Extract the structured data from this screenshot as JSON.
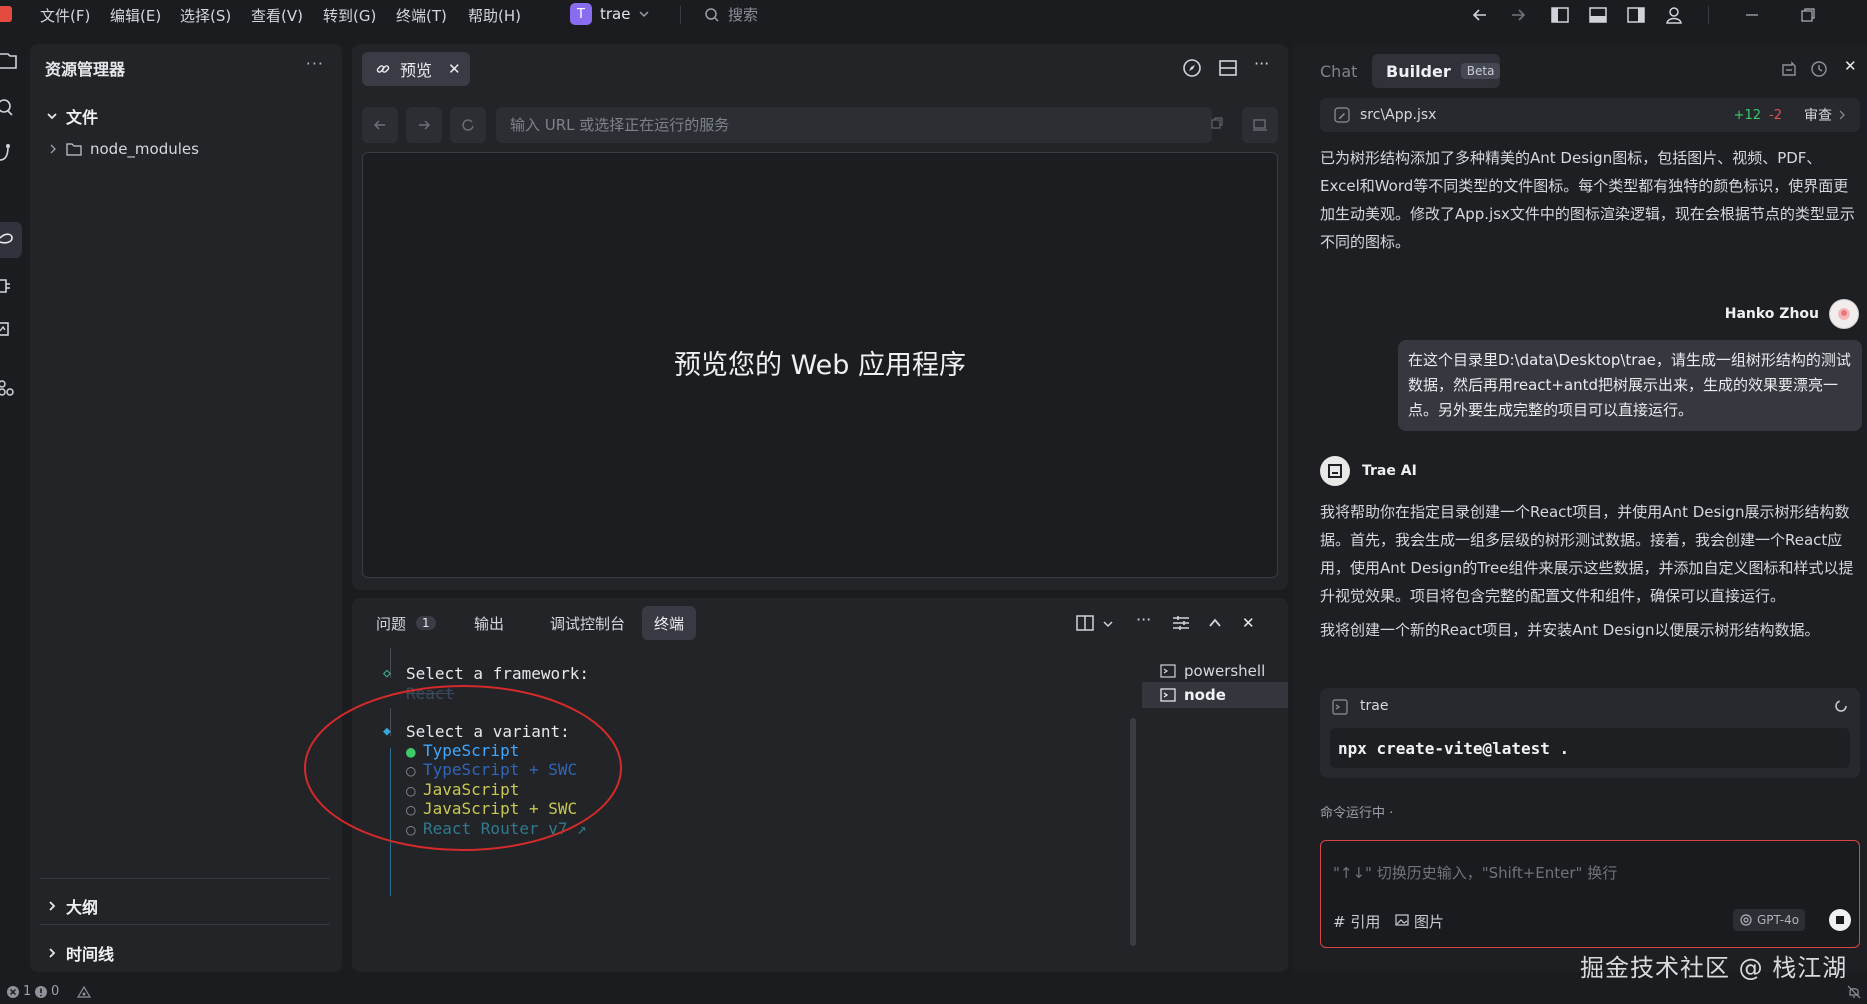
{
  "menu": {
    "items": [
      "文件(F)",
      "编辑(E)",
      "选择(S)",
      "查看(V)",
      "转到(G)",
      "终端(T)",
      "帮助(H)"
    ],
    "project_initial": "T",
    "project_name": "trae",
    "search_label": "搜索"
  },
  "explorer": {
    "title": "资源管理器",
    "more": "···",
    "files_section": "文件",
    "folder": "node_modules",
    "outline_section": "大纲",
    "timeline_section": "时间线"
  },
  "preview": {
    "tab_label": "预览",
    "url_placeholder": "输入 URL 或选择正在运行的服务",
    "message": "预览您的 Web 应用程序"
  },
  "panel": {
    "tabs": [
      {
        "label": "问题",
        "badge": "1"
      },
      {
        "label": "输出"
      },
      {
        "label": "调试控制台"
      },
      {
        "label": "终端"
      }
    ],
    "terminals": [
      "powershell",
      "node"
    ]
  },
  "terminal": {
    "framework_prompt": "Select a framework:",
    "framework_value": "React",
    "variant_prompt": "Select a variant:",
    "options": [
      {
        "label": "TypeScript",
        "selected": true,
        "color": "#3da8ff"
      },
      {
        "label": "TypeScript + SWC",
        "selected": false,
        "color": "#2f66b8"
      },
      {
        "label": "JavaScript",
        "selected": false,
        "color": "#c9c94e"
      },
      {
        "label": "JavaScript + SWC",
        "selected": false,
        "color": "#c9c94e"
      },
      {
        "label": "React Router v7 ↗",
        "selected": false,
        "color": "#2f7a8e"
      }
    ],
    "annotation_color": "#d42a2a"
  },
  "chat": {
    "tab_chat": "Chat",
    "tab_builder": "Builder",
    "beta": "Beta",
    "file_name": "src\\App.jsx",
    "additions": "+12",
    "deletions": "-2",
    "review": "审查",
    "ai_summary": "已为树形结构添加了多种精美的Ant Design图标，包括图片、视频、PDF、Excel和Word等不同类型的文件图标。每个类型都有独特的颜色标识，使界面更加生动美观。修改了App.jsx文件中的图标渲染逻辑，现在会根据节点的类型显示不同的图标。",
    "user_name": "Hanko Zhou",
    "user_message": "在这个目录里D:\\data\\Desktop\\trae，请生成一组树形结构的测试数据，然后再用react+antd把树展示出来，生成的效果要漂亮一点。另外要生成完整的项目可以直接运行。",
    "ai_name": "Trae AI",
    "ai_reply_1": "我将帮助你在指定目录创建一个React项目，并使用Ant Design展示树形结构数据。首先，我会生成一组多层级的树形测试数据。接着，我会创建一个React应用，使用Ant Design的Tree组件来展示这些数据，并添加自定义图标和样式以提升视觉效果。项目将包含完整的配置文件和组件，确保可以直接运行。",
    "ai_reply_2": "我将创建一个新的React项目，并安装Ant Design以便展示树形结构数据。",
    "cmd_title": "trae",
    "cmd_code": "npx create-vite@latest .",
    "running_status": "命令运行中 ·",
    "input_placeholder": "\"↑↓\" 切换历史输入，\"Shift+Enter\" 换行",
    "ref_label": "# 引用",
    "image_label": "图片",
    "model": "GPT-4o"
  },
  "status": {
    "errors": "1",
    "warnings": "0"
  },
  "watermark": "掘金技术社区 @ 栈江湖"
}
